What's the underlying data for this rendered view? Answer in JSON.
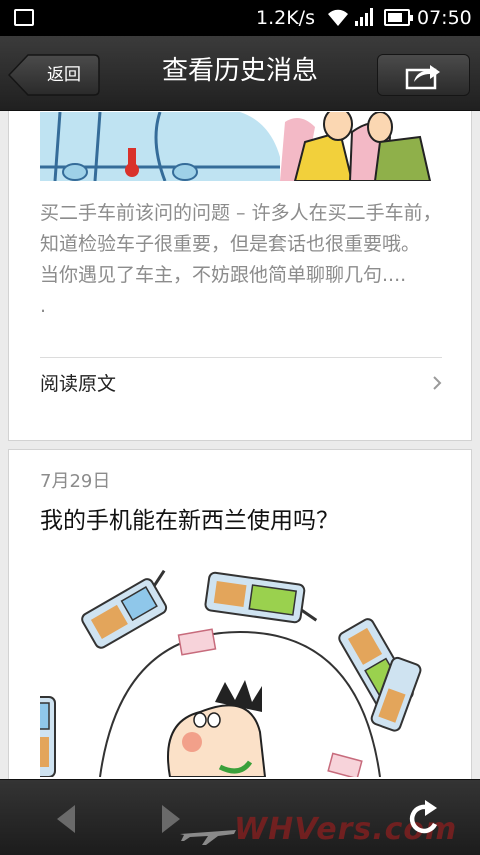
{
  "status_bar": {
    "net_speed": "1.2K/s",
    "time": "07:50",
    "icons": [
      "image-icon",
      "wifi-icon",
      "signal-icon",
      "battery-icon"
    ]
  },
  "header": {
    "back_label": "返回",
    "title": "查看历史消息",
    "share_icon": "share-icon"
  },
  "articles": [
    {
      "excerpt_line1": "买二手车前该问的问题 – 许多人在买二手车前，知道检验车子很重要，但是套话也很重要哦。",
      "excerpt_line2": "当你遇见了车主，不妨跟他简单聊聊几句....",
      "excerpt_line3": ".",
      "read_more": "阅读原文",
      "image": "cartoon-car-illustration"
    },
    {
      "date": "7月29日",
      "title": "我的手机能在新西兰使用吗？",
      "image": "cartoon-phones-illustration"
    }
  ],
  "toolbar": {
    "back_icon": "arrow-left-icon",
    "forward_icon": "arrow-right-icon",
    "refresh_icon": "refresh-icon",
    "watermark": "WHVers.com"
  },
  "colors": {
    "bar_dark": "#2a2a2a",
    "page_bg": "#ebebeb",
    "card_bg": "#ffffff",
    "excerpt_text": "#8c8c8c"
  }
}
